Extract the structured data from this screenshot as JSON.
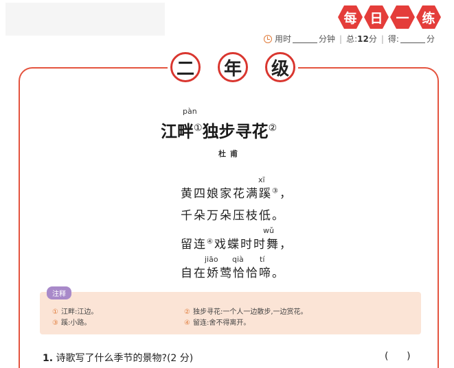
{
  "header": {
    "badges": [
      "每",
      "日",
      "一",
      "练"
    ]
  },
  "stats": {
    "time_label": "用时",
    "minutes_label": "分钟",
    "total_label": "总:",
    "total_score": "12",
    "score_unit": "分",
    "got_label": "得:",
    "got_unit": "分"
  },
  "grade": [
    "二",
    "年",
    "级"
  ],
  "poem": {
    "title_part1": "江畔",
    "mark1": "①",
    "title_part2": "独步寻花",
    "mark2": "②",
    "title_pinyin": "pàn",
    "author": "杜甫",
    "lines": [
      {
        "text": "黄四娘家花满蹊",
        "mark": "③",
        "end": "，",
        "pinyin": "xī"
      },
      {
        "text": "千朵万朵压枝低。",
        "mark": "",
        "end": "",
        "pinyin": ""
      },
      {
        "text_a": "留连",
        "mark": "④",
        "text_b": "戏蝶时时舞，",
        "pinyin": "wǔ"
      },
      {
        "text": "自在娇莺恰恰啼。",
        "mark": "",
        "end": "",
        "pinyin_a": "jiāo",
        "pinyin_b": "qià",
        "pinyin_c": "tí"
      }
    ]
  },
  "notes": {
    "tag": "注释",
    "items": [
      {
        "num": "①",
        "text": "江畔:江边。"
      },
      {
        "num": "②",
        "text": "独步寻花:一个人一边散步,一边赏花。"
      },
      {
        "num": "③",
        "text": "蹊:小路。"
      },
      {
        "num": "④",
        "text": "留连:舍不得离开。"
      }
    ]
  },
  "question": {
    "number": "1.",
    "text": "诗歌写了什么季节的景物?(2 分)",
    "bracket": "(      )"
  }
}
